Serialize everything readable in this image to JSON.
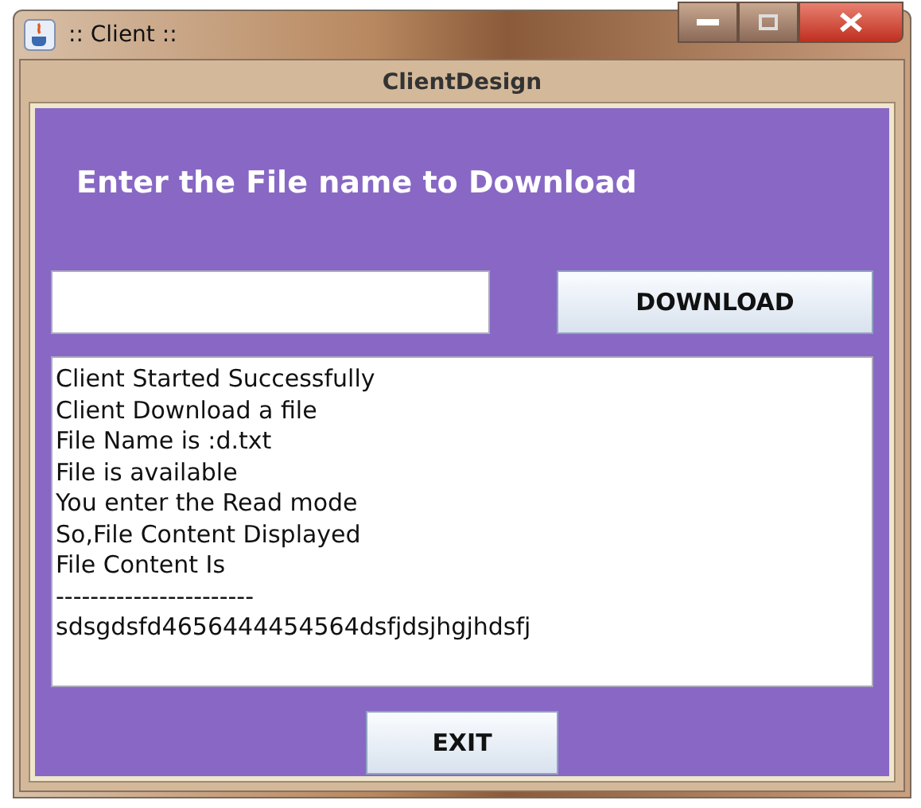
{
  "window": {
    "title": ":: Client ::"
  },
  "panel": {
    "title": "ClientDesign"
  },
  "heading": "Enter the File name to Download",
  "download_button": "DOWNLOAD",
  "log_lines": [
    "Client Started Successfully",
    "Client Download a file",
    "File Name is :d.txt",
    "File is available",
    "You enter the Read mode",
    "So,File Content Displayed",
    "File Content Is",
    "-----------------------",
    "sdsgdsfd4656444454564dsfjdsjhgjhdsfj"
  ],
  "exit_button": "EXIT"
}
